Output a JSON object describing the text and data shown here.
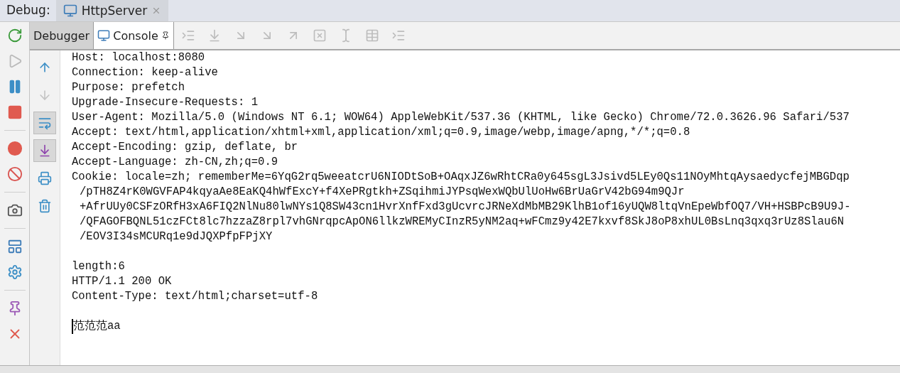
{
  "header": {
    "label": "Debug:",
    "session_tab": {
      "title": "HttpServer",
      "selected": true
    }
  },
  "sub_tabs": [
    {
      "label": "Debugger",
      "selected": false
    },
    {
      "label": "Console",
      "selected": true
    }
  ],
  "console_side_tools": [
    {
      "on": false,
      "disabled": false
    },
    {
      "on": false,
      "disabled": true
    },
    {
      "on": true,
      "disabled": false
    },
    {
      "on": true,
      "disabled": false
    },
    {
      "on": false,
      "disabled": false
    },
    {
      "on": false,
      "disabled": false
    }
  ],
  "console_blocks": [
    [
      {
        "text": "Host: localhost:8080",
        "continuation": false
      },
      {
        "text": "Connection: keep-alive",
        "continuation": false
      },
      {
        "text": "Purpose: prefetch",
        "continuation": false
      },
      {
        "text": "Upgrade-Insecure-Requests: 1",
        "continuation": false
      },
      {
        "text": "User-Agent: Mozilla/5.0 (Windows NT 6.1; WOW64) AppleWebKit/537.36 (KHTML, like Gecko) Chrome/72.0.3626.96 Safari/537",
        "continuation": false
      },
      {
        "text": "Accept: text/html,application/xhtml+xml,application/xml;q=0.9,image/webp,image/apng,*/*;q=0.8",
        "continuation": false
      },
      {
        "text": "Accept-Encoding: gzip, deflate, br",
        "continuation": false
      },
      {
        "text": "Accept-Language: zh-CN,zh;q=0.9",
        "continuation": false
      },
      {
        "text": "Cookie: locale=zh; rememberMe=6YqG2rq5weeatcrU6NIODtSoB+OAqxJZ6wRhtCRa0y645sgL3Jsivd5LEy0Qs11NOyMhtqAysaedycfejMBGDqp",
        "continuation": false
      },
      {
        "text": "/pTH8Z4rK0WGVFAP4kqyaAe8EaKQ4hWfExcY+f4XePRgtkh+ZSqihmiJYPsqWexWQbUlUoHw6BrUaGrV42bG94m9QJr",
        "continuation": true
      },
      {
        "text": "+AfrUUy0CSFzORfH3xA6FIQ2NlNu80lwNYs1Q8SW43cn1HvrXnfFxd3gUcvrcJRNeXdMbMB29KlhB1of16yUQW8ltqVnEpeWbfOQ7/VH+HSBPcB9U9J-",
        "continuation": true
      },
      {
        "text": "/QFAGOFBQNL51czFCt8lc7hzzaZ8rpl7vhGNrqpcApON6llkzWREMyCInzR5yNM2aq+wFCmz9y42E7kxvf8SkJ8oP8xhUL0BsLnq3qxq3rUz8Slau6N",
        "continuation": true
      },
      {
        "text": "/EOV3I34sMCURq1e9dJQXPfpFPjXY",
        "continuation": true
      }
    ],
    [
      {
        "text": "length:6",
        "continuation": false
      },
      {
        "text": "HTTP/1.1 200 OK",
        "continuation": false
      },
      {
        "text": "Content-Type: text/html;charset=utf-8",
        "continuation": false
      }
    ],
    [
      {
        "text": "范范范aa",
        "continuation": false,
        "caret": true
      }
    ]
  ]
}
